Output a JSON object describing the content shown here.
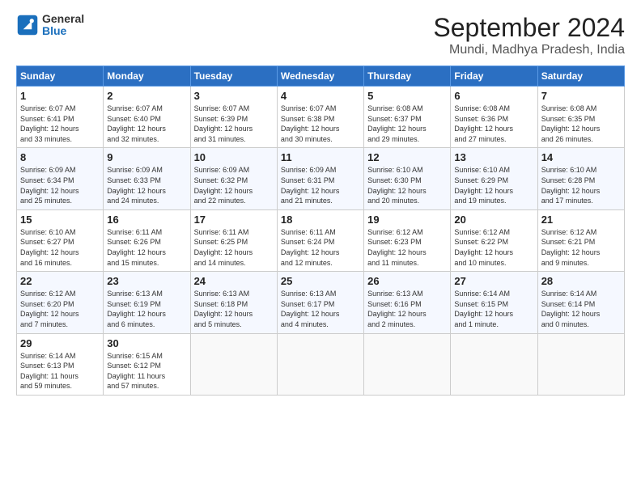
{
  "logo": {
    "general": "General",
    "blue": "Blue"
  },
  "header": {
    "title": "September 2024",
    "subtitle": "Mundi, Madhya Pradesh, India"
  },
  "weekdays": [
    "Sunday",
    "Monday",
    "Tuesday",
    "Wednesday",
    "Thursday",
    "Friday",
    "Saturday"
  ],
  "weeks": [
    [
      {
        "day": "1",
        "info": "Sunrise: 6:07 AM\nSunset: 6:41 PM\nDaylight: 12 hours\nand 33 minutes."
      },
      {
        "day": "2",
        "info": "Sunrise: 6:07 AM\nSunset: 6:40 PM\nDaylight: 12 hours\nand 32 minutes."
      },
      {
        "day": "3",
        "info": "Sunrise: 6:07 AM\nSunset: 6:39 PM\nDaylight: 12 hours\nand 31 minutes."
      },
      {
        "day": "4",
        "info": "Sunrise: 6:07 AM\nSunset: 6:38 PM\nDaylight: 12 hours\nand 30 minutes."
      },
      {
        "day": "5",
        "info": "Sunrise: 6:08 AM\nSunset: 6:37 PM\nDaylight: 12 hours\nand 29 minutes."
      },
      {
        "day": "6",
        "info": "Sunrise: 6:08 AM\nSunset: 6:36 PM\nDaylight: 12 hours\nand 27 minutes."
      },
      {
        "day": "7",
        "info": "Sunrise: 6:08 AM\nSunset: 6:35 PM\nDaylight: 12 hours\nand 26 minutes."
      }
    ],
    [
      {
        "day": "8",
        "info": "Sunrise: 6:09 AM\nSunset: 6:34 PM\nDaylight: 12 hours\nand 25 minutes."
      },
      {
        "day": "9",
        "info": "Sunrise: 6:09 AM\nSunset: 6:33 PM\nDaylight: 12 hours\nand 24 minutes."
      },
      {
        "day": "10",
        "info": "Sunrise: 6:09 AM\nSunset: 6:32 PM\nDaylight: 12 hours\nand 22 minutes."
      },
      {
        "day": "11",
        "info": "Sunrise: 6:09 AM\nSunset: 6:31 PM\nDaylight: 12 hours\nand 21 minutes."
      },
      {
        "day": "12",
        "info": "Sunrise: 6:10 AM\nSunset: 6:30 PM\nDaylight: 12 hours\nand 20 minutes."
      },
      {
        "day": "13",
        "info": "Sunrise: 6:10 AM\nSunset: 6:29 PM\nDaylight: 12 hours\nand 19 minutes."
      },
      {
        "day": "14",
        "info": "Sunrise: 6:10 AM\nSunset: 6:28 PM\nDaylight: 12 hours\nand 17 minutes."
      }
    ],
    [
      {
        "day": "15",
        "info": "Sunrise: 6:10 AM\nSunset: 6:27 PM\nDaylight: 12 hours\nand 16 minutes."
      },
      {
        "day": "16",
        "info": "Sunrise: 6:11 AM\nSunset: 6:26 PM\nDaylight: 12 hours\nand 15 minutes."
      },
      {
        "day": "17",
        "info": "Sunrise: 6:11 AM\nSunset: 6:25 PM\nDaylight: 12 hours\nand 14 minutes."
      },
      {
        "day": "18",
        "info": "Sunrise: 6:11 AM\nSunset: 6:24 PM\nDaylight: 12 hours\nand 12 minutes."
      },
      {
        "day": "19",
        "info": "Sunrise: 6:12 AM\nSunset: 6:23 PM\nDaylight: 12 hours\nand 11 minutes."
      },
      {
        "day": "20",
        "info": "Sunrise: 6:12 AM\nSunset: 6:22 PM\nDaylight: 12 hours\nand 10 minutes."
      },
      {
        "day": "21",
        "info": "Sunrise: 6:12 AM\nSunset: 6:21 PM\nDaylight: 12 hours\nand 9 minutes."
      }
    ],
    [
      {
        "day": "22",
        "info": "Sunrise: 6:12 AM\nSunset: 6:20 PM\nDaylight: 12 hours\nand 7 minutes."
      },
      {
        "day": "23",
        "info": "Sunrise: 6:13 AM\nSunset: 6:19 PM\nDaylight: 12 hours\nand 6 minutes."
      },
      {
        "day": "24",
        "info": "Sunrise: 6:13 AM\nSunset: 6:18 PM\nDaylight: 12 hours\nand 5 minutes."
      },
      {
        "day": "25",
        "info": "Sunrise: 6:13 AM\nSunset: 6:17 PM\nDaylight: 12 hours\nand 4 minutes."
      },
      {
        "day": "26",
        "info": "Sunrise: 6:13 AM\nSunset: 6:16 PM\nDaylight: 12 hours\nand 2 minutes."
      },
      {
        "day": "27",
        "info": "Sunrise: 6:14 AM\nSunset: 6:15 PM\nDaylight: 12 hours\nand 1 minute."
      },
      {
        "day": "28",
        "info": "Sunrise: 6:14 AM\nSunset: 6:14 PM\nDaylight: 12 hours\nand 0 minutes."
      }
    ],
    [
      {
        "day": "29",
        "info": "Sunrise: 6:14 AM\nSunset: 6:13 PM\nDaylight: 11 hours\nand 59 minutes."
      },
      {
        "day": "30",
        "info": "Sunrise: 6:15 AM\nSunset: 6:12 PM\nDaylight: 11 hours\nand 57 minutes."
      },
      {
        "day": "",
        "info": ""
      },
      {
        "day": "",
        "info": ""
      },
      {
        "day": "",
        "info": ""
      },
      {
        "day": "",
        "info": ""
      },
      {
        "day": "",
        "info": ""
      }
    ]
  ]
}
